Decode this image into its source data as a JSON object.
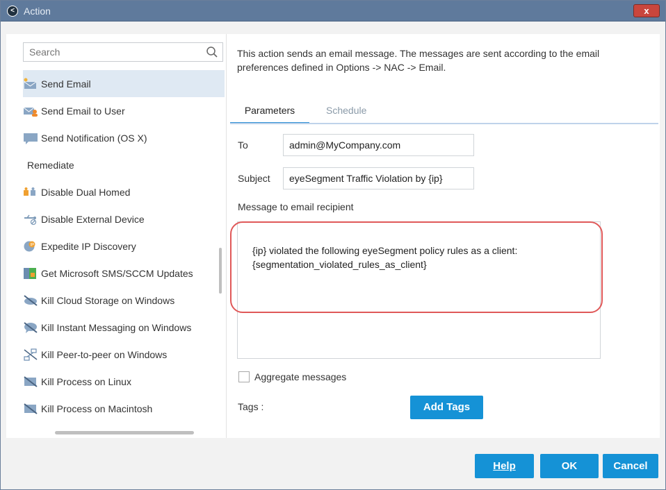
{
  "window": {
    "title": "Action",
    "close_label": "x"
  },
  "search": {
    "placeholder": "Search"
  },
  "sidebar": {
    "items": [
      {
        "label": "Send Email",
        "icon": "email-send-icon",
        "selected": true
      },
      {
        "label": "Send Email to User",
        "icon": "email-user-icon"
      },
      {
        "label": "Send Notification (OS X)",
        "icon": "notification-icon"
      },
      {
        "label": "Remediate",
        "section": true
      },
      {
        "label": "Disable Dual Homed",
        "icon": "dual-homed-icon"
      },
      {
        "label": "Disable External Device",
        "icon": "usb-icon"
      },
      {
        "label": "Expedite IP Discovery",
        "icon": "ip-discovery-icon"
      },
      {
        "label": "Get Microsoft SMS/SCCM Updates",
        "icon": "sccm-icon"
      },
      {
        "label": "Kill Cloud Storage on Windows",
        "icon": "kill-icon"
      },
      {
        "label": "Kill Instant Messaging on Windows",
        "icon": "kill-icon"
      },
      {
        "label": "Kill Peer-to-peer on Windows",
        "icon": "p2p-icon"
      },
      {
        "label": "Kill Process on Linux",
        "icon": "kill-icon"
      },
      {
        "label": "Kill Process on Macintosh",
        "icon": "kill-icon"
      }
    ]
  },
  "main": {
    "description": "This action sends an email message. The messages are sent according to the email preferences defined in Options -> NAC -> Email.",
    "tabs": [
      {
        "label": "Parameters",
        "active": true
      },
      {
        "label": "Schedule",
        "active": false
      }
    ],
    "to_label": "To",
    "to_value": "admin@MyCompany.com",
    "subject_label": "Subject",
    "subject_value": "eyeSegment Traffic Violation by {ip}",
    "message_label": "Message to email recipient",
    "message_line1": "{ip} violated the following eyeSegment policy rules as a client:",
    "message_line2": "{segmentation_violated_rules_as_client}",
    "aggregate_label": "Aggregate messages",
    "aggregate_checked": false,
    "tags_label": "Tags :",
    "add_tags_label": "Add Tags"
  },
  "footer": {
    "help_label": "Help",
    "ok_label": "OK",
    "cancel_label": "Cancel"
  },
  "colors": {
    "accent": "#1592d6",
    "highlight": "#e05858",
    "titlebar": "#5f7a9c"
  }
}
